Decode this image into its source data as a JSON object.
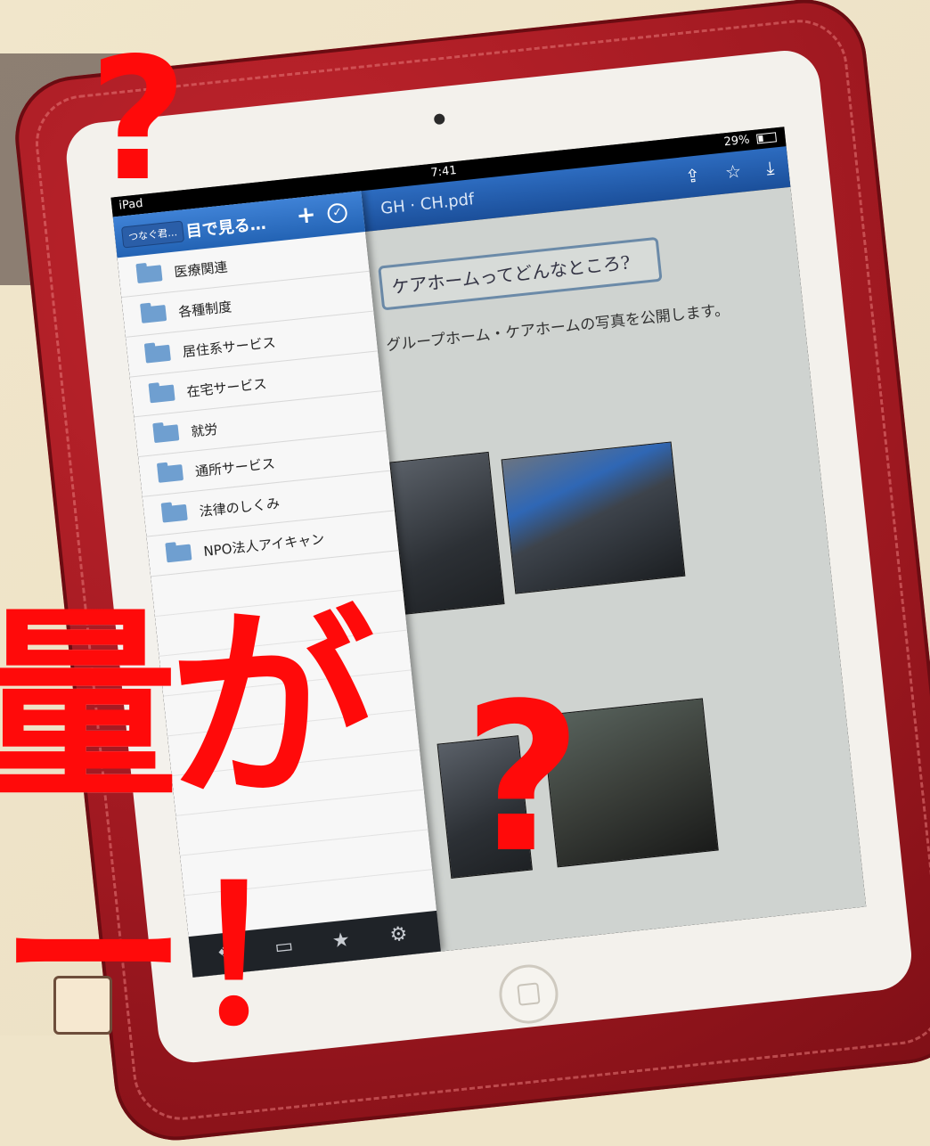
{
  "status_bar": {
    "device": "iPad",
    "time": "7:41",
    "battery": "29%"
  },
  "toolbar": {
    "doc_title": "GH · CH.pdf",
    "icons": [
      "share-icon",
      "star-icon",
      "download-icon"
    ]
  },
  "sidebar": {
    "back_label": "つなぐ君…",
    "title": "目で見る…",
    "plus_label": "+",
    "check_label": "✓",
    "folders": [
      {
        "label": "医療関連"
      },
      {
        "label": "各種制度"
      },
      {
        "label": "居住系サービス"
      },
      {
        "label": "在宅サービス"
      },
      {
        "label": "就労"
      },
      {
        "label": "通所サービス"
      },
      {
        "label": "法律のしくみ"
      },
      {
        "label": "NPO法人アイキャン"
      }
    ],
    "footer_icons": [
      "dropbox-icon",
      "image-icon",
      "star-icon",
      "gear-icon"
    ]
  },
  "pdf": {
    "heading": "ケアホームってどんなところ?",
    "text": "グループホーム・ケアホームの写真を公開します。"
  },
  "overlay": {
    "question_top": "?",
    "question_bottom": "?",
    "big_text": "量が",
    "big_text_2": "ー！"
  }
}
